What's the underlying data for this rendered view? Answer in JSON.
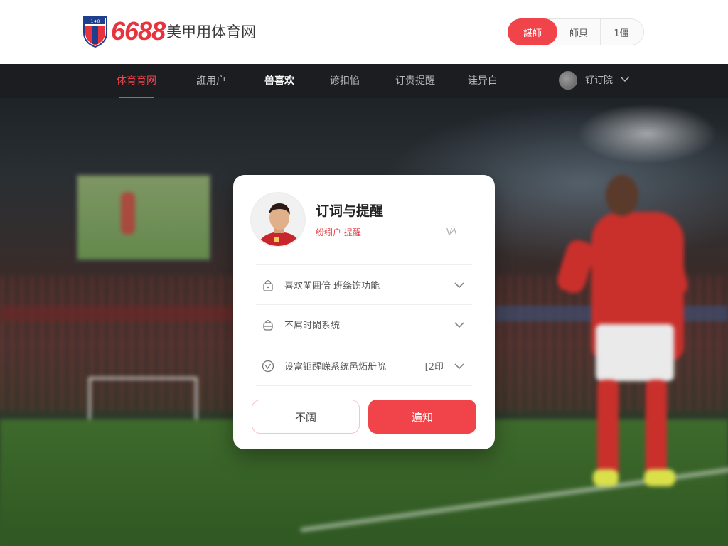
{
  "brand": {
    "number": "6688",
    "text": "美甲用体育网",
    "accent": "#f0444a"
  },
  "top_actions": {
    "primary": "諶師",
    "secondary": "師貝",
    "tertiary": "1僵"
  },
  "nav": {
    "items": [
      {
        "label": "体育育网",
        "state": "active"
      },
      {
        "label": "誑用户",
        "state": "normal"
      },
      {
        "label": "兽喜欢",
        "state": "bold"
      },
      {
        "label": "谚扣惂",
        "state": "normal"
      },
      {
        "label": "订贵提醒",
        "state": "normal"
      },
      {
        "label": "诖异白",
        "state": "normal"
      }
    ],
    "user": {
      "name": "钌订院",
      "icon": "avatar"
    }
  },
  "modal": {
    "title": "订词与提醒",
    "subtitle": "纷纼户 提醒",
    "close_glyph": "\\/⁄\\",
    "rows": [
      {
        "icon": "lock-icon",
        "label": "喜欢閘囲倍 班绦饬功能",
        "badge": ""
      },
      {
        "icon": "lock-open-icon",
        "label": "不屌时閖系统",
        "badge": ""
      },
      {
        "icon": "shield-check-icon",
        "label": "设富钷醒嵘系统邑炻册阭",
        "badge": "[2印"
      }
    ],
    "cancel_label": "不阔",
    "confirm_label": "遍知"
  }
}
